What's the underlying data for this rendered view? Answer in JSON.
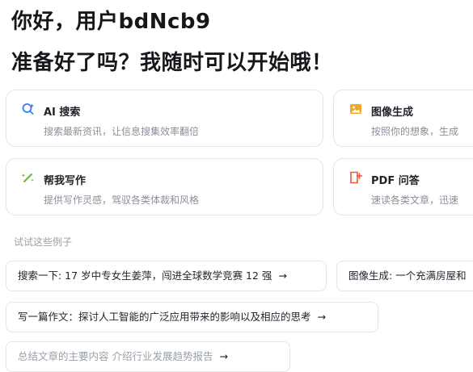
{
  "greeting": {
    "line1": "你好，用户bdNcb9",
    "line2": "准备好了吗？我随时可以开始哦！"
  },
  "cards": [
    {
      "title": "AI 搜索",
      "desc": "搜索最新资讯，让信息搜集效率翻倍",
      "icon": "ai-search-icon",
      "color": "#3a7bf7"
    },
    {
      "title": "图像生成",
      "desc": "按照你的想象，生成",
      "icon": "image-generation-icon",
      "color": "#f5a623"
    },
    {
      "title": "帮我写作",
      "desc": "提供写作灵感，驾驭各类体裁和风格",
      "icon": "writing-icon",
      "color": "#52c41a"
    },
    {
      "title": "PDF 问答",
      "desc": "速读各类文章，迅速",
      "icon": "pdf-qa-icon",
      "color": "#f5533d"
    }
  ],
  "examples": {
    "label": "试试这些例子",
    "items": [
      "搜索一下: 17 岁中专女生姜萍，闯进全球数学竞赛 12 强",
      "图像生成: 一个充满房屋和",
      "写一篇作文：探讨人工智能的广泛应用带来的影响以及相应的思考",
      "总结文章的主要内容 介绍行业发展趋势报告"
    ],
    "arrow": "→"
  }
}
